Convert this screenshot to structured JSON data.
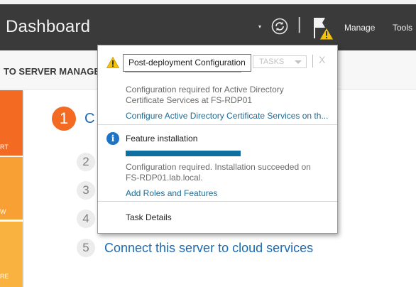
{
  "header": {
    "title": "Dashboard",
    "refresh_dropdown_glyph": "▾",
    "divider_glyph": "|",
    "menu": [
      "Manage",
      "Tools"
    ],
    "icons": {
      "refresh": "refresh-icon",
      "notifications": "notification-flag-warning-icon"
    }
  },
  "welcome": {
    "label": "TO SERVER MANAGE"
  },
  "tiles": [
    {
      "label": "RT",
      "color": "#f36a22"
    },
    {
      "label": "W",
      "color": "#f8a033"
    },
    {
      "label": "RE",
      "color": "#f9b140"
    }
  ],
  "steps": [
    {
      "number": "1",
      "label": "C"
    },
    {
      "number": "2",
      "label": ""
    },
    {
      "number": "3",
      "label": ""
    },
    {
      "number": "4",
      "label": ""
    },
    {
      "number": "5",
      "label": "Connect this server to cloud services"
    }
  ],
  "notifications": {
    "items": [
      {
        "icon": "warning-icon",
        "tasks_label": "TASKS",
        "dismiss_glyph": "X",
        "body_lines": [
          "Configuration required for Active Directory",
          "Certificate Services at FS-RDP01"
        ],
        "link": "Configure Active Directory Certificate Services on th..."
      },
      {
        "icon": "info-icon",
        "icon_glyph": "i",
        "title": "Feature installation",
        "progress_fraction": 1.0,
        "body_lines": [
          "Configuration required. Installation succeeded on",
          "FS-RDP01.lab.local."
        ],
        "link": "Add Roles and Features"
      }
    ],
    "task_details": "Task Details"
  },
  "tooltip": {
    "text": "Post-deployment Configuration"
  },
  "colors": {
    "header_bg": "#3a3a3a",
    "link": "#1b6ab5",
    "popup_link": "#1e6b95",
    "step_accent": "#f36a22",
    "progress": "#0f6fa0",
    "warning": "#f4c20d",
    "info": "#1c74c6"
  }
}
